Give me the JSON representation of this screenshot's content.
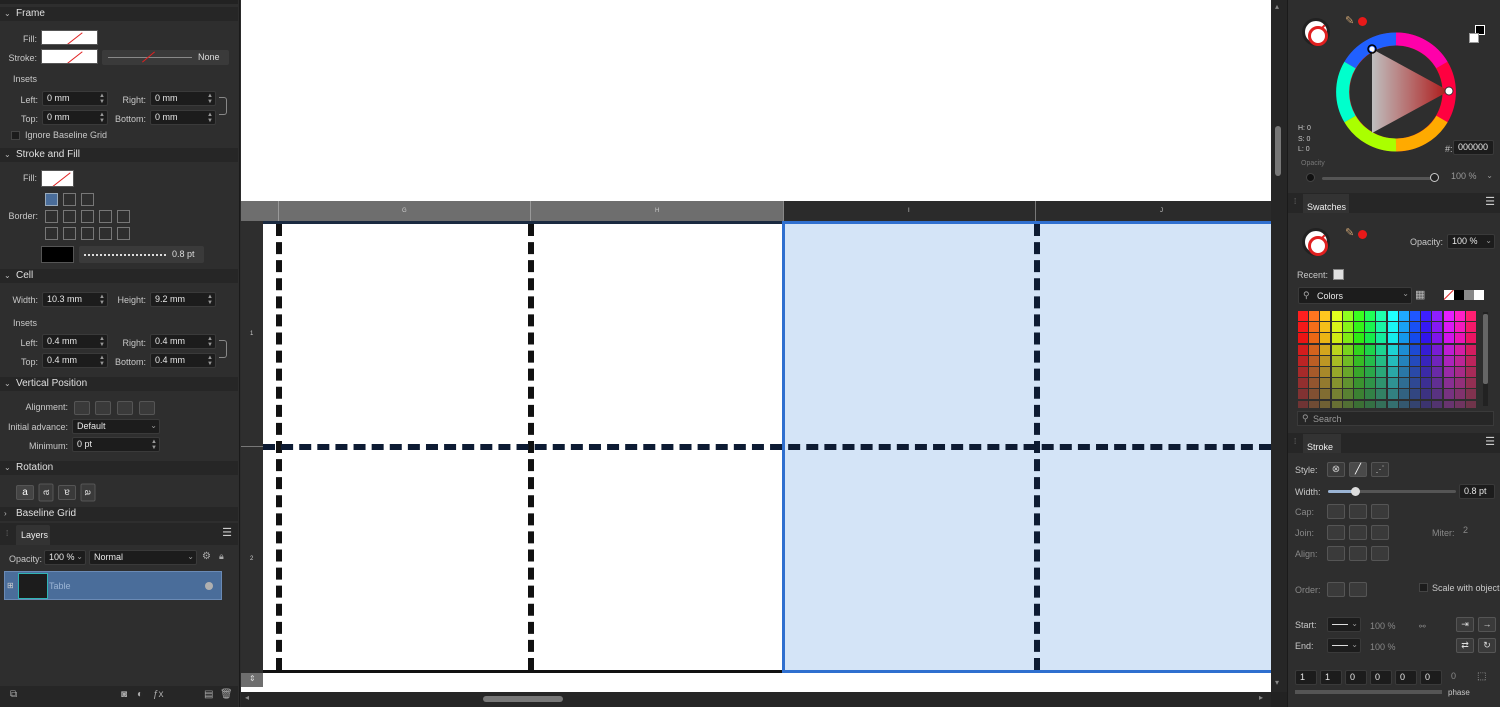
{
  "left_panel": {
    "frame": {
      "title": "Frame",
      "fill_label": "Fill:",
      "stroke_label": "Stroke:",
      "stroke_value": "None",
      "insets_label": "Insets",
      "left_label": "Left:",
      "left_value": "0 mm",
      "right_label": "Right:",
      "right_value": "0 mm",
      "top_label": "Top:",
      "top_value": "0 mm",
      "bottom_label": "Bottom:",
      "bottom_value": "0 mm",
      "ignore_baseline": "Ignore Baseline Grid"
    },
    "stroke_fill": {
      "title": "Stroke and Fill",
      "fill_label": "Fill:",
      "border_label": "Border:",
      "stroke_width": "0.8 pt"
    },
    "cell": {
      "title": "Cell",
      "width_label": "Width:",
      "width_value": "10.3 mm",
      "height_label": "Height:",
      "height_value": "9.2 mm",
      "insets_label": "Insets",
      "left_label": "Left:",
      "left_value": "0.4 mm",
      "right_label": "Right:",
      "right_value": "0.4 mm",
      "top_label": "Top:",
      "top_value": "0.4 mm",
      "bottom_label": "Bottom:",
      "bottom_value": "0.4 mm"
    },
    "vertical_position": {
      "title": "Vertical Position",
      "alignment_label": "Alignment:",
      "initial_advance_label": "Initial advance:",
      "initial_advance_value": "Default",
      "minimum_label": "Minimum:",
      "minimum_value": "0 pt"
    },
    "rotation": {
      "title": "Rotation",
      "glyphs": [
        "a",
        "ɐ",
        "ɐ",
        "ɐ"
      ]
    },
    "baseline_grid": {
      "title": "Baseline Grid"
    },
    "layers": {
      "tab": "Layers",
      "opacity_label": "Opacity:",
      "opacity_value": "100 %",
      "blend_mode": "Normal",
      "layer_name": "Table"
    }
  },
  "canvas": {
    "columns": [
      "G",
      "H",
      "I",
      "J"
    ],
    "rows": [
      "1",
      "2"
    ]
  },
  "right_panel": {
    "color": {
      "h": "H: 0",
      "s": "S: 0",
      "l": "L: 0",
      "hex_label": "#:",
      "hex_value": "000000",
      "opacity_label": "Opacity",
      "opacity_value": "100 %"
    },
    "swatches": {
      "tab": "Swatches",
      "opacity_label": "Opacity:",
      "opacity_value": "100 %",
      "recent_label": "Recent:",
      "palette_name": "Colors",
      "search_placeholder": "Search"
    },
    "stroke": {
      "tab": "Stroke",
      "style_label": "Style:",
      "width_label": "Width:",
      "width_value": "0.8 pt",
      "cap_label": "Cap:",
      "join_label": "Join:",
      "miter_label": "Miter:",
      "miter_value": "2",
      "align_label": "Align:",
      "order_label": "Order:",
      "scale_label": "Scale with object",
      "start_label": "Start:",
      "start_scale": "100 %",
      "end_label": "End:",
      "end_scale": "100 %",
      "dash_values": [
        "1",
        "1",
        "0",
        "0",
        "0",
        "0"
      ],
      "dash_last": "0",
      "phase_label": "phase"
    }
  },
  "colors": {
    "selection_fill": "#d4e4f7",
    "selection_border": "#2f6fcf",
    "layer_selected": "#4a6d9a"
  }
}
